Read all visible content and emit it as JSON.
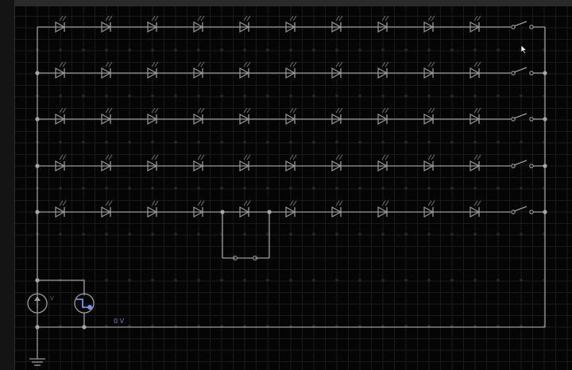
{
  "circuit": {
    "voltage_probe_label": "0 V",
    "led_rows": 5,
    "led_columns": 10,
    "switches": 5,
    "source_label": "V"
  },
  "colors": {
    "background": "#050505",
    "grid": "#1a1a1a",
    "wire": "#9a9a9a",
    "probe": "#6a7fc8"
  }
}
